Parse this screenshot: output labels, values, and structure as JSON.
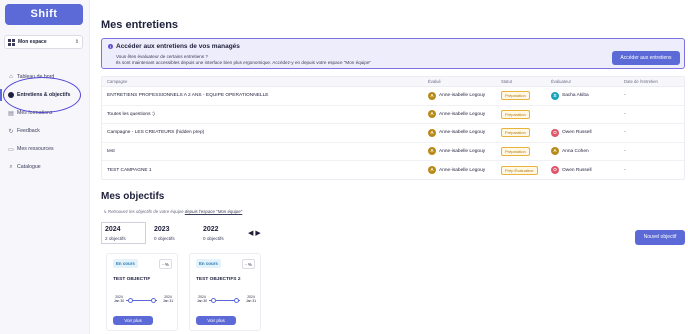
{
  "sidebar": {
    "logo": "Shift",
    "space": {
      "label": "Mon espace"
    },
    "items": [
      {
        "label": "Tableau de bord",
        "icon": "home-icon"
      },
      {
        "label": "Entretiens & objectifs",
        "icon": "dot-icon",
        "active": true
      },
      {
        "label": "Mes formations",
        "icon": "book-icon"
      },
      {
        "label": "Feedback",
        "icon": "refresh-icon"
      },
      {
        "label": "Mes ressources",
        "icon": "folder-icon"
      },
      {
        "label": "Catalogue",
        "icon": "search-icon"
      }
    ]
  },
  "page": {
    "title": "Mes entretiens"
  },
  "banner": {
    "title": "Accéder aux entretiens de vos managés",
    "line1": "Vous êtes évaluateur de certains entretiens ?",
    "line2": "Ils sont maintenant accessibles depuis une interface bien plus ergonomique. Accédez-y en depuis votre espace \"Mon équipe\"",
    "button": "Accéder aux entretiens"
  },
  "table": {
    "headers": [
      "Campagne",
      "Évalué",
      "Statut",
      "Évaluateur",
      "Date de l'entretien"
    ],
    "rows": [
      {
        "campaign": "ENTRETIENS PROFESSIONNELS A 2 ANS - EQUIPE OPERATIONNELLE",
        "evaluee": "Anne-isabelle Legouy",
        "evaluee_initial": "A",
        "status": "Préparation",
        "evaluator": "Sacha Akiba",
        "evaluator_initial": "S",
        "evaluator_color": "#1aa3b8",
        "date": "-"
      },
      {
        "campaign": "Toutes les questions :)",
        "evaluee": "Anne-isabelle Legouy",
        "evaluee_initial": "A",
        "status": "Préparation",
        "evaluator": "",
        "evaluator_initial": "",
        "evaluator_color": "",
        "date": "-"
      },
      {
        "campaign": "Campagne - LES CREATEURS (hidden prep)",
        "evaluee": "Anne-isabelle Legouy",
        "evaluee_initial": "A",
        "status": "Préparation",
        "evaluator": "Owen Russell",
        "evaluator_initial": "O",
        "evaluator_color": "#e0566a",
        "date": "-"
      },
      {
        "campaign": "test",
        "evaluee": "Anne-isabelle Legouy",
        "evaluee_initial": "A",
        "status": "Préparation",
        "evaluator": "Anna Cohen",
        "evaluator_initial": "A",
        "evaluator_color": "#b88a1a",
        "date": "-"
      },
      {
        "campaign": "TEST CAMPAGNE 1",
        "evaluee": "Anne-isabelle Legouy",
        "evaluee_initial": "A",
        "status": "Prép Évaluateur",
        "evaluator": "Owen Russell",
        "evaluator_initial": "O",
        "evaluator_color": "#e0566a",
        "date": "-"
      }
    ]
  },
  "objectives": {
    "title": "Mes objectifs",
    "hint_prefix": "Retrouvez les objectifs de votre équipe ",
    "hint_link": "depuis l'espace \"Mon équipe\"",
    "years": [
      {
        "year": "2024",
        "count": "2 objectifs",
        "active": true
      },
      {
        "year": "2023",
        "count": "0 objectifs"
      },
      {
        "year": "2022",
        "count": "0 objectifs"
      }
    ],
    "new_button": "Nouvel objectif",
    "cards": [
      {
        "status": "En cours",
        "pct": "- %",
        "title": "TEST OBJECTIF",
        "start": "2024 Jan 30",
        "end": "2024 Jan 31",
        "more": "Voir plus"
      },
      {
        "status": "En cours",
        "pct": "- %",
        "title": "TEST OBJECTIFS 2",
        "start": "2024 Jan 30",
        "end": "2024 Jan 31",
        "more": "Voir plus"
      }
    ]
  },
  "colors": {
    "accent": "#5b6ad6",
    "avatar_evaluee": "#b88a1a",
    "badge": "#e8b33a"
  }
}
